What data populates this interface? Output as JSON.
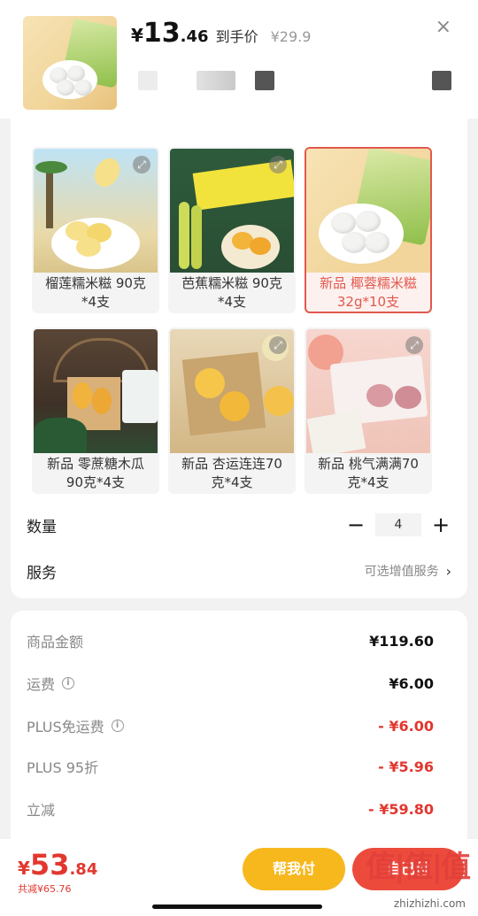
{
  "header": {
    "price_symbol": "¥",
    "price_int": "13",
    "price_dec": ".46",
    "price_tag": "到手价",
    "original_price": "¥29.9",
    "close_icon": "×"
  },
  "products": [
    {
      "label": "榴莲糯米糍 90克*4支",
      "selected": false
    },
    {
      "label": "芭蕉糯米糍 90克*4支",
      "selected": false
    },
    {
      "label": "新品 椰蓉糯米糍32g*10支",
      "selected": true
    },
    {
      "label": "新品 零蔗糖木瓜 90克*4支",
      "selected": false
    },
    {
      "label": "新品 杏运连连70克*4支",
      "selected": false
    },
    {
      "label": "新品 桃气满满70克*4支",
      "selected": false
    }
  ],
  "quantity": {
    "label": "数量",
    "value": "4",
    "minus": "−",
    "plus": "+"
  },
  "service": {
    "label": "服务",
    "value": "可选增值服务",
    "chevron": "›"
  },
  "amounts": [
    {
      "label": "商品金额",
      "value": "¥119.60",
      "red": false,
      "info": false
    },
    {
      "label": "运费",
      "value": "¥6.00",
      "red": false,
      "info": true
    },
    {
      "label": "PLUS免运费",
      "value": "- ¥6.00",
      "red": true,
      "info": true
    },
    {
      "label": "PLUS 95折",
      "value": "- ¥5.96",
      "red": true,
      "info": false
    },
    {
      "label": "立减",
      "value": "- ¥59.80",
      "red": true,
      "info": false
    }
  ],
  "bottom": {
    "total_symbol": "¥",
    "total_int": "53",
    "total_dec": ".84",
    "saved": "共减¥65.76",
    "help_button": "帮我付",
    "pay_button": "自己付",
    "watermark": "值|值|值",
    "watermark_url": "zhizhizhi.com"
  },
  "colors": {
    "accent_red": "#e2372f",
    "selected_border": "#e2584d",
    "help_yellow": "#f7b81e"
  }
}
